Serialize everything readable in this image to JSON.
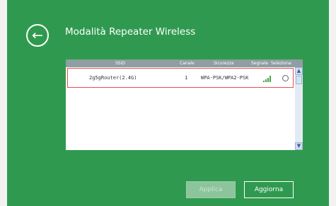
{
  "header": {
    "back_icon": "arrow-left-circle-icon",
    "title": "Modalità Repeater Wireless"
  },
  "table": {
    "columns": [
      "SSID",
      "Canale",
      "Sicurezza",
      "Segnale",
      "Seleziona"
    ],
    "rows": [
      {
        "ssid": "2g5gRouter(2.4G)",
        "channel": "1",
        "security": "WPA-PSK/WPA2-PSK",
        "signal_icon": "signal-bars-icon",
        "signal_level": 1.0,
        "selected": false
      }
    ]
  },
  "scrollbar": {
    "up_glyph": "▲",
    "down_glyph": "▼"
  },
  "buttons": {
    "apply_label": "Applica",
    "apply_enabled": false,
    "refresh_label": "Aggiorna"
  },
  "colors": {
    "panel_bg": "#2f9a4f",
    "table_header_bg": "#8e9ea2",
    "row_highlight_border": "#e55050"
  }
}
